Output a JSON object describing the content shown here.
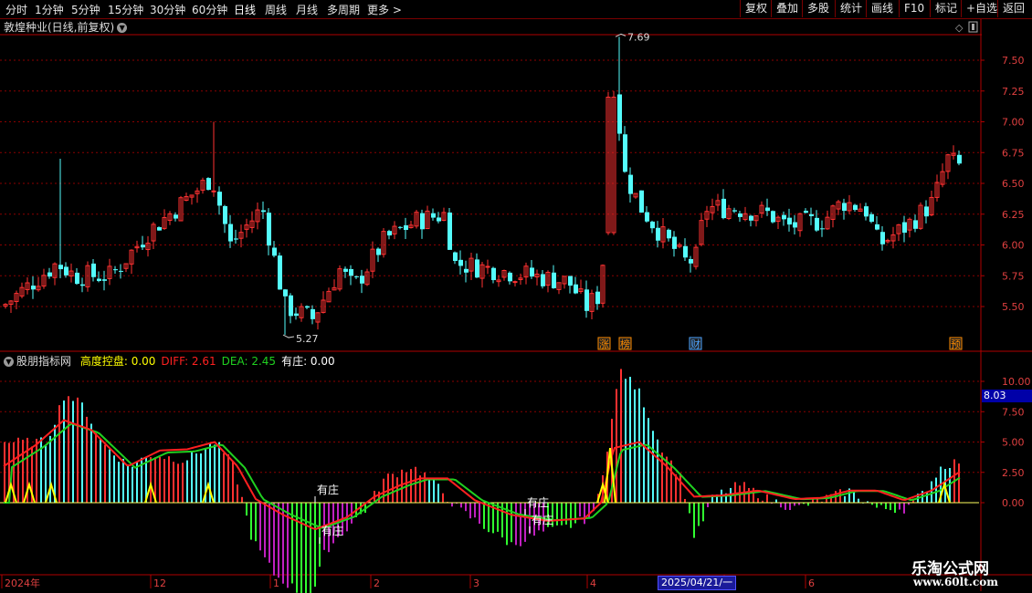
{
  "toolbar": {
    "periods": [
      "分时",
      "1分钟",
      "5分钟",
      "15分钟",
      "30分钟",
      "60分钟",
      "日线",
      "周线",
      "月线",
      "多周期",
      "更多"
    ],
    "active_period": "日线",
    "right_buttons": [
      "复权",
      "叠加",
      "多股",
      "统计",
      "画线",
      "F10",
      "标记",
      "+自选",
      "返回"
    ]
  },
  "main": {
    "title": "敦煌种业(日线,前复权)",
    "high_label": "7.69",
    "low_label": "5.27",
    "y_ticks": [
      "7.50",
      "7.25",
      "7.00",
      "6.75",
      "6.50",
      "6.25",
      "6.00",
      "5.75",
      "5.50"
    ],
    "event_tags": [
      "涨",
      "榜",
      "财",
      "预"
    ]
  },
  "indicator": {
    "name": "股朋指标网",
    "items": [
      {
        "label": "高度控盘:",
        "value": "0.00",
        "color": "#ffff00"
      },
      {
        "label": "DIFF:",
        "value": "2.61",
        "color": "#ff2020"
      },
      {
        "label": "DEA:",
        "value": "2.45",
        "color": "#20d020"
      },
      {
        "label": "有庄:",
        "value": "0.00",
        "color": "#ffffff"
      }
    ],
    "y_ticks": [
      "10.00",
      "7.50",
      "5.00",
      "2.50",
      "0.00"
    ],
    "current_value": "8.03",
    "annotations": [
      "有庄",
      "有庄",
      "有庄",
      "有庄"
    ]
  },
  "x_axis": {
    "labels": [
      "2024年",
      "12",
      "1",
      "2",
      "3",
      "4",
      "5",
      "6"
    ],
    "cursor_date": "2025/04/21/一"
  },
  "watermark": {
    "line1": "乐淘公式网",
    "line2": "www.60lt.com"
  },
  "colors": {
    "up": "#ff3232",
    "down": "#54fcfc",
    "grid": "#8b0000",
    "axis": "#b00000",
    "diff": "#ff2020",
    "dea": "#20d020"
  }
}
